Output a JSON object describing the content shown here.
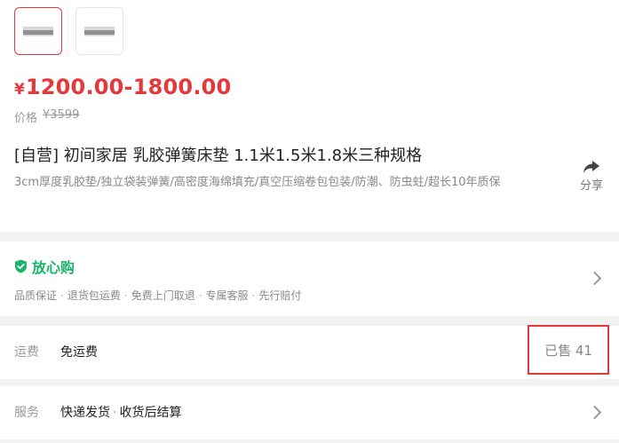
{
  "product": {
    "price_currency": "¥",
    "price_range": "1200.00-1800.00",
    "original_label": "价格",
    "original_price": "¥3599",
    "title": "[自营] 初间家居 乳胶弹簧床垫 1.1米1.5米1.8米三种规格",
    "subtitle": "3cm厚度乳胶垫/独立袋装弹簧/高密度海绵填充/真空压缩卷包包装/防潮、防虫蛀/超长10年质保",
    "share_label": "分享"
  },
  "guarantee": {
    "title": "放心购",
    "items": [
      "品质保证",
      "退货包运费",
      "免费上门取退",
      "专属客服",
      "先行赔付"
    ]
  },
  "shipping": {
    "label": "运费",
    "value": "免运费",
    "sold_text": "已售 41"
  },
  "service": {
    "label": "服务",
    "items": [
      "快递发货",
      "收货后结算"
    ]
  },
  "colors": {
    "price_red": "#e4393c",
    "guarantee_green": "#18b566",
    "highlight_border": "#e4393c"
  }
}
